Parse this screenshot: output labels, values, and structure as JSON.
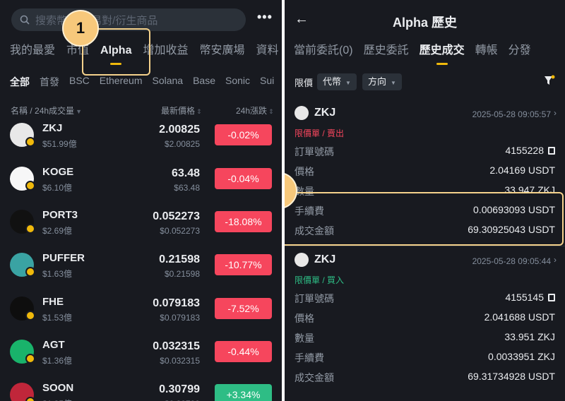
{
  "left": {
    "search_placeholder": "搜索幣種/交易對/衍生商品",
    "tabs": [
      {
        "label": "我的最愛"
      },
      {
        "label": "市值"
      },
      {
        "label": "Alpha"
      },
      {
        "label": "增加收益"
      },
      {
        "label": "幣安廣場"
      },
      {
        "label": "資料"
      }
    ],
    "chips": [
      "全部",
      "首發",
      "BSC",
      "Ethereum",
      "Solana",
      "Base",
      "Sonic",
      "Sui"
    ],
    "col_name": "名稱",
    "col_vol": "24h成交量",
    "col_price": "最新價格",
    "col_change": "24h漲跌",
    "coins": [
      {
        "symbol": "ZKJ",
        "vol": "$51.99億",
        "price": "2.00825",
        "sub": "$2.00825",
        "change": "-0.02%",
        "dir": "neg",
        "color": "#e8e8e8"
      },
      {
        "symbol": "KOGE",
        "vol": "$6.10億",
        "price": "63.48",
        "sub": "$63.48",
        "change": "-0.04%",
        "dir": "neg",
        "color": "#f7f7f7"
      },
      {
        "symbol": "PORT3",
        "vol": "$2.69億",
        "price": "0.052273",
        "sub": "$0.052273",
        "change": "-18.08%",
        "dir": "neg",
        "color": "#111111"
      },
      {
        "symbol": "PUFFER",
        "vol": "$1.63億",
        "price": "0.21598",
        "sub": "$0.21598",
        "change": "-10.77%",
        "dir": "neg",
        "color": "#3aa3a3"
      },
      {
        "symbol": "FHE",
        "vol": "$1.53億",
        "price": "0.079183",
        "sub": "$0.079183",
        "change": "-7.52%",
        "dir": "neg",
        "color": "#0e0e0e"
      },
      {
        "symbol": "AGT",
        "vol": "$1.36億",
        "price": "0.032315",
        "sub": "$0.032315",
        "change": "-0.44%",
        "dir": "neg",
        "color": "#19b36b"
      },
      {
        "symbol": "SOON",
        "vol": "$1.35億",
        "price": "0.30799",
        "sub": "$0.30799",
        "change": "+3.34%",
        "dir": "pos",
        "color": "#c0263a"
      }
    ]
  },
  "right": {
    "title": "Alpha 歷史",
    "tabs": [
      {
        "label": "當前委託(0)"
      },
      {
        "label": "歷史委託"
      },
      {
        "label": "歷史成交"
      },
      {
        "label": "轉帳"
      },
      {
        "label": "分發"
      }
    ],
    "filter_label": "限價",
    "filter_token": "代幣",
    "filter_side": "方向",
    "trades": [
      {
        "name": "ZKJ",
        "date": "2025-05-28 09:05:57",
        "order_type": "限價單 / 賣出",
        "side": "sell",
        "rows": [
          {
            "label": "訂單號碼",
            "value": "4155228"
          },
          {
            "label": "價格",
            "value": "2.04169 USDT"
          },
          {
            "label": "數量",
            "value": "33.947 ZKJ"
          },
          {
            "label": "手續費",
            "value": "0.00693093 USDT"
          },
          {
            "label": "成交金額",
            "value": "69.30925043 USDT"
          }
        ]
      },
      {
        "name": "ZKJ",
        "date": "2025-05-28 09:05:44",
        "order_type": "限價單 / 買入",
        "side": "buy",
        "rows": [
          {
            "label": "訂單號碼",
            "value": "4155145"
          },
          {
            "label": "價格",
            "value": "2.041688 USDT"
          },
          {
            "label": "數量",
            "value": "33.951 ZKJ"
          },
          {
            "label": "手續費",
            "value": "0.0033951 ZKJ"
          },
          {
            "label": "成交金額",
            "value": "69.31734928 USDT"
          }
        ]
      }
    ]
  },
  "annotations": {
    "badge1": "1",
    "badge2": "2"
  },
  "colors": {
    "accent": "#f0b90b",
    "negative": "#f6465d",
    "positive": "#2ebd85",
    "background": "#181a20",
    "annotation": "#f7c87b"
  }
}
